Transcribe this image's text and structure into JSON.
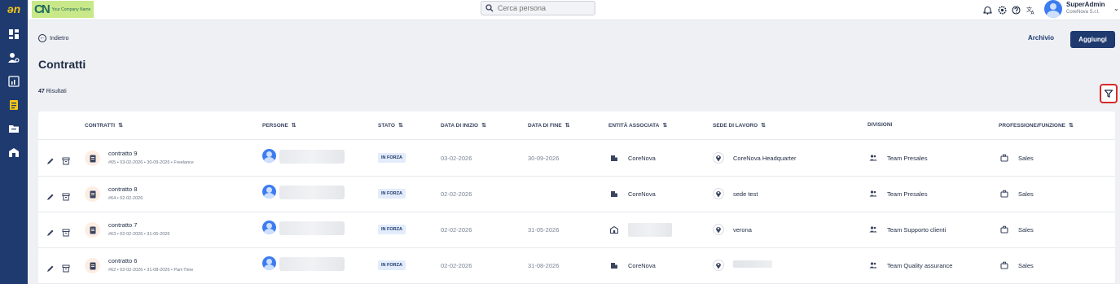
{
  "topbar": {
    "company_logo_mark": "CN",
    "company_logo_text": "Your Company Name",
    "search_placeholder": "Cerca persona",
    "user_name": "SuperAdmin",
    "user_company": "CoreNova S.r.l."
  },
  "sidebar": {
    "logo": "ən",
    "items": [
      "dashboard",
      "people",
      "reports",
      "contracts",
      "documents",
      "company"
    ]
  },
  "page": {
    "back_label": "Indietro",
    "title": "Contratti",
    "results_count": "47",
    "results_label": "Risultati",
    "archive_label": "Archivio",
    "add_label": "Aggiungi"
  },
  "table": {
    "headers": {
      "contratti": "CONTRATTI",
      "persone": "PERSONE",
      "stato": "STATO",
      "data_inizio": "DATA DI INIZIO",
      "data_fine": "DATA DI FINE",
      "entita": "ENTITÀ ASSOCIATA",
      "sede": "SEDE DI LAVORO",
      "divisioni": "DIVISIONI",
      "professione": "PROFESSIONE/FUNZIONE"
    },
    "rows": [
      {
        "title": "contratto 9",
        "subtitle": "#65 • 03-02-2026 • 30-09-2026 • Freelance",
        "status": "IN FORZA",
        "start": "03-02-2026",
        "end": "30-09-2026",
        "entity": "CoreNova",
        "site": "CoreNova Headquarter",
        "division": "Team Presales",
        "profession": "Sales"
      },
      {
        "title": "contratto 8",
        "subtitle": "#64 • 02-02-2026",
        "status": "IN FORZA",
        "start": "02-02-2026",
        "end": "",
        "entity": "CoreNova",
        "site": "sede test",
        "division": "Team Presales",
        "profession": "Sales"
      },
      {
        "title": "contratto 7",
        "subtitle": "#63 • 02-02-2026 • 31-05-2026",
        "status": "IN FORZA",
        "start": "02-02-2026",
        "end": "31-05-2026",
        "entity": "",
        "site": "verona",
        "division": "Team Supporto clienti",
        "profession": "Sales"
      },
      {
        "title": "contratto 6",
        "subtitle": "#62 • 02-02-2026 • 31-08-2026 • Part-Time",
        "status": "IN FORZA",
        "start": "02-02-2026",
        "end": "31-08-2026",
        "entity": "CoreNova",
        "site": "",
        "division": "Team Quality assurance",
        "profession": "Sales"
      }
    ]
  },
  "colors": {
    "sidebar": "#1e3a6e",
    "primary": "#1e3a6e",
    "highlight": "#d62b2b",
    "avatar": "#3d7cf0",
    "badge_bg": "#e3ecfa"
  }
}
